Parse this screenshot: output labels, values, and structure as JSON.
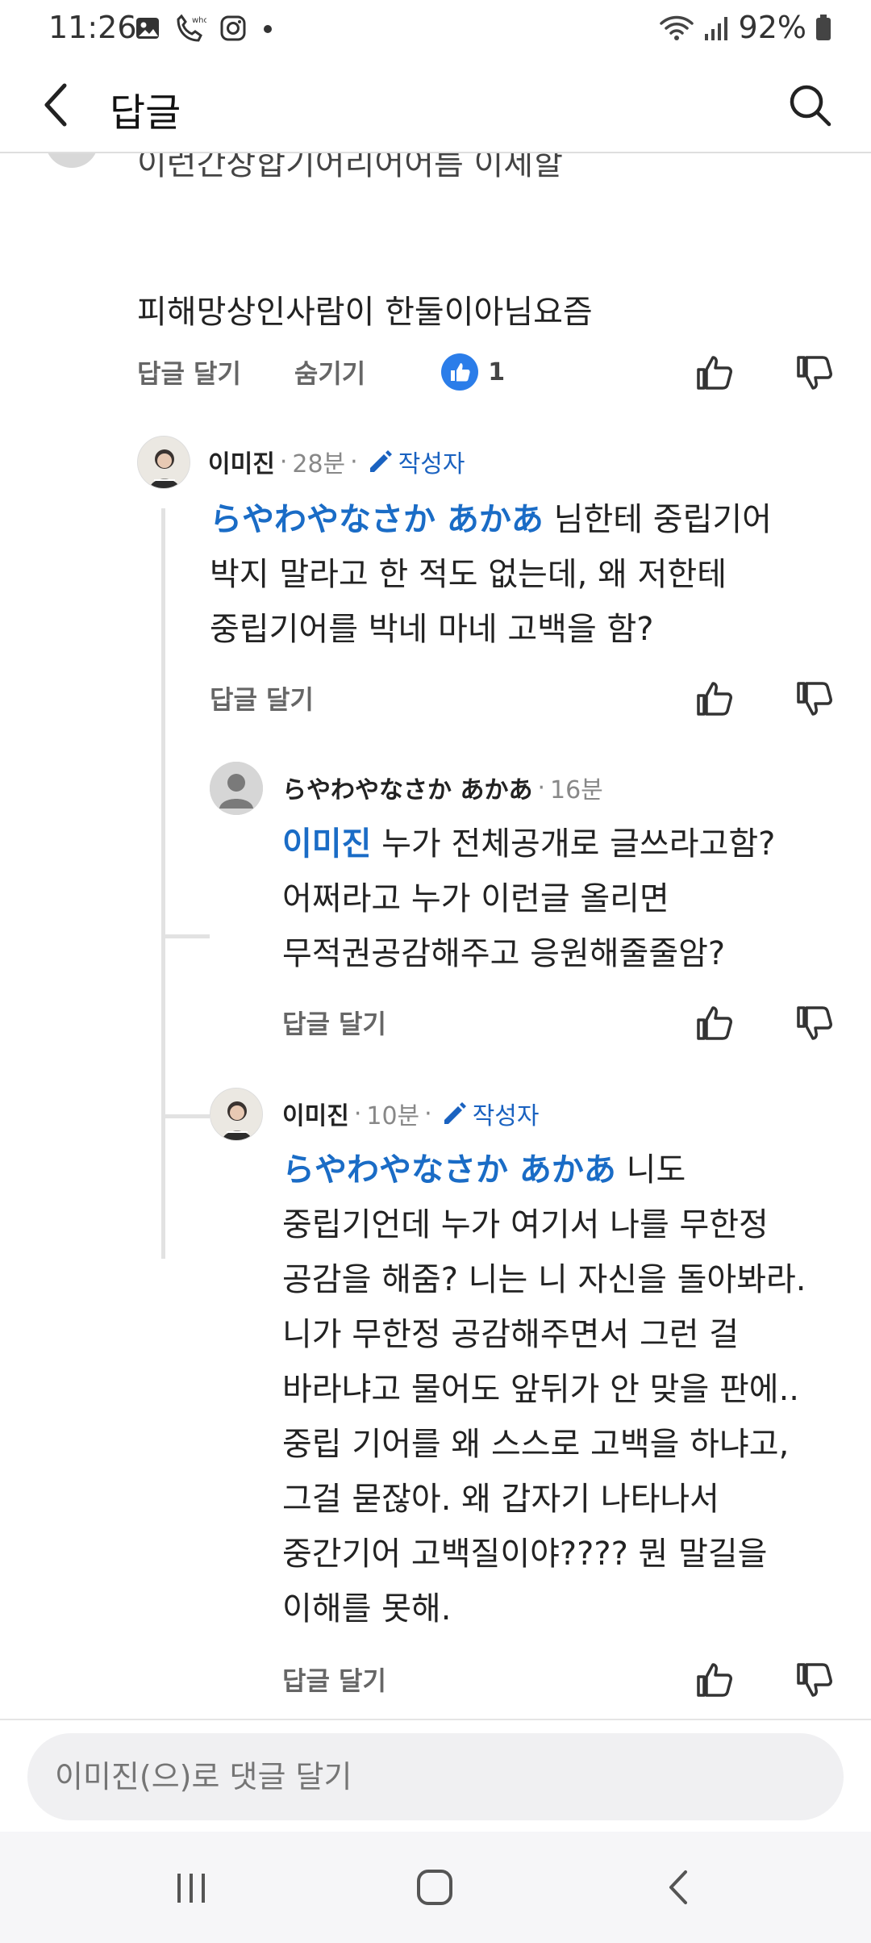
{
  "status_bar": {
    "time": "11:26",
    "battery": "92%"
  },
  "header": {
    "title": "답글"
  },
  "top_comment": {
    "cut_line": "이런간장합기어리어어름 이제할",
    "last_line": "피해망상인사람이 한둘이아님요즘",
    "reply_label": "답글 달기",
    "hide_label": "숨기기",
    "like_count": "1"
  },
  "replies": [
    {
      "author": "이미진",
      "time": "28분",
      "badge": "작성자",
      "mention": "らやわやなさか あかあ",
      "lines": [
        "님한테 중립기어",
        "박지 말라고 한 적도 없는데, 왜 저한테",
        "중립기어를 박네 마네 고백을 함?"
      ],
      "reply_label": "답글 달기"
    },
    {
      "author": "らやわやなさか あかあ",
      "time": "16분",
      "mention": "이미진",
      "lines": [
        "누가 전체공개로 글쓰라고함?",
        "어쩌라고 누가 이런글 올리면",
        "무적권공감해주고 응원해줄줄암?"
      ],
      "reply_label": "답글 달기"
    },
    {
      "author": "이미진",
      "time": "10분",
      "badge": "작성자",
      "mention": "らやわやなさか あかあ",
      "lines": [
        "니도",
        "중립기언데 누가 여기서 나를 무한정",
        "공감을 해줌? 니는 니 자신을 돌아봐라.",
        "니가 무한정 공감해주면서 그런 걸",
        "바라냐고 물어도 앞뒤가 안 맞을 판에..",
        "중립 기어를 왜 스스로 고백을 하냐고,",
        "그걸 묻잖아. 왜 갑자기 나타나서",
        "중간기어 고백질이야???? 뭔 말길을",
        "이해를 못해."
      ],
      "reply_label": "답글 달기"
    }
  ],
  "input": {
    "placeholder": "이미진(으)로 댓글 달기"
  },
  "colors": {
    "accent": "#1a6cc6",
    "like_badge": "#2b7de9"
  }
}
